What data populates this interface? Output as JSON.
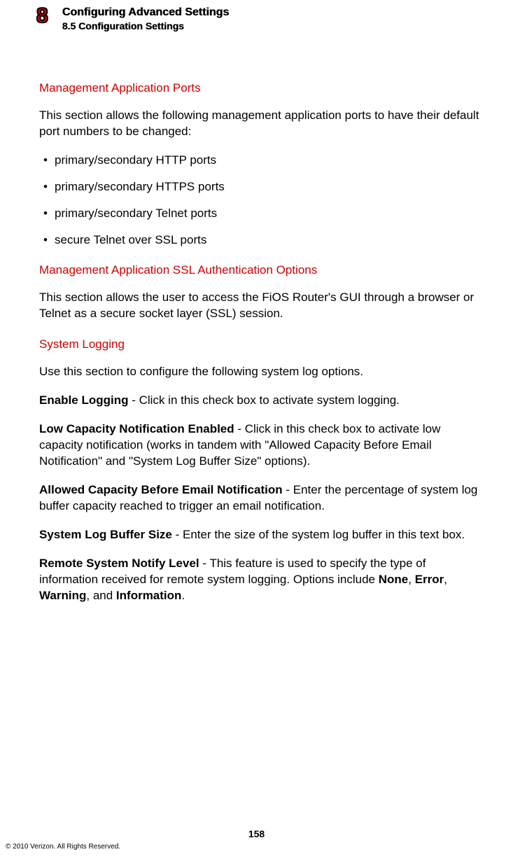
{
  "header": {
    "chapter_number": "8",
    "chapter_title": "Configuring Advanced Settings",
    "section_label": "8.5  Configuration Settings"
  },
  "sections": {
    "mgmt_ports": {
      "heading": "Management Application Ports",
      "intro": "This section allows the following management application ports to have their default port numbers to be changed:",
      "bullets": [
        "primary/secondary HTTP ports",
        "primary/secondary HTTPS ports",
        "primary/secondary Telnet ports",
        "secure Telnet over SSL ports"
      ]
    },
    "ssl_auth": {
      "heading": "Management Application SSL Authentication Options",
      "body": "This section allows the user to access the FiOS Router's GUI through a browser or Telnet as a secure socket layer (SSL) session."
    },
    "sys_log": {
      "heading": "System Logging",
      "intro": "Use this section to configure the following system log options.",
      "enable_label": "Enable Logging",
      "enable_text": " - Click in this check box to activate system logging.",
      "lowcap_label": "Low Capacity Notification Enabled",
      "lowcap_text": " - Click in this check box to activate low capacity notification (works in tandem with \"Allowed Capacity Before Email Notification\" and \"System Log Buffer Size\" options).",
      "allowed_label": "Allowed Capacity Before Email Notification",
      "allowed_text": " - Enter the percentage of system log buffer capacity reached to trigger an email notification.",
      "buffer_label": "System Log Buffer Size",
      "buffer_text": " - Enter the size of the system log buffer in this text box.",
      "remote_label": "Remote System Notify Level",
      "remote_text_1": " - This feature is used to specify the type of information received for remote system logging. Options include ",
      "opt_none": "None",
      "sep1": ", ",
      "opt_error": "Error",
      "sep2": ", ",
      "opt_warning": "Warning",
      "sep3": ", and ",
      "opt_info": "Information",
      "period": "."
    }
  },
  "footer": {
    "page_number": "158",
    "copyright": "© 2010 Verizon. All Rights Reserved."
  }
}
